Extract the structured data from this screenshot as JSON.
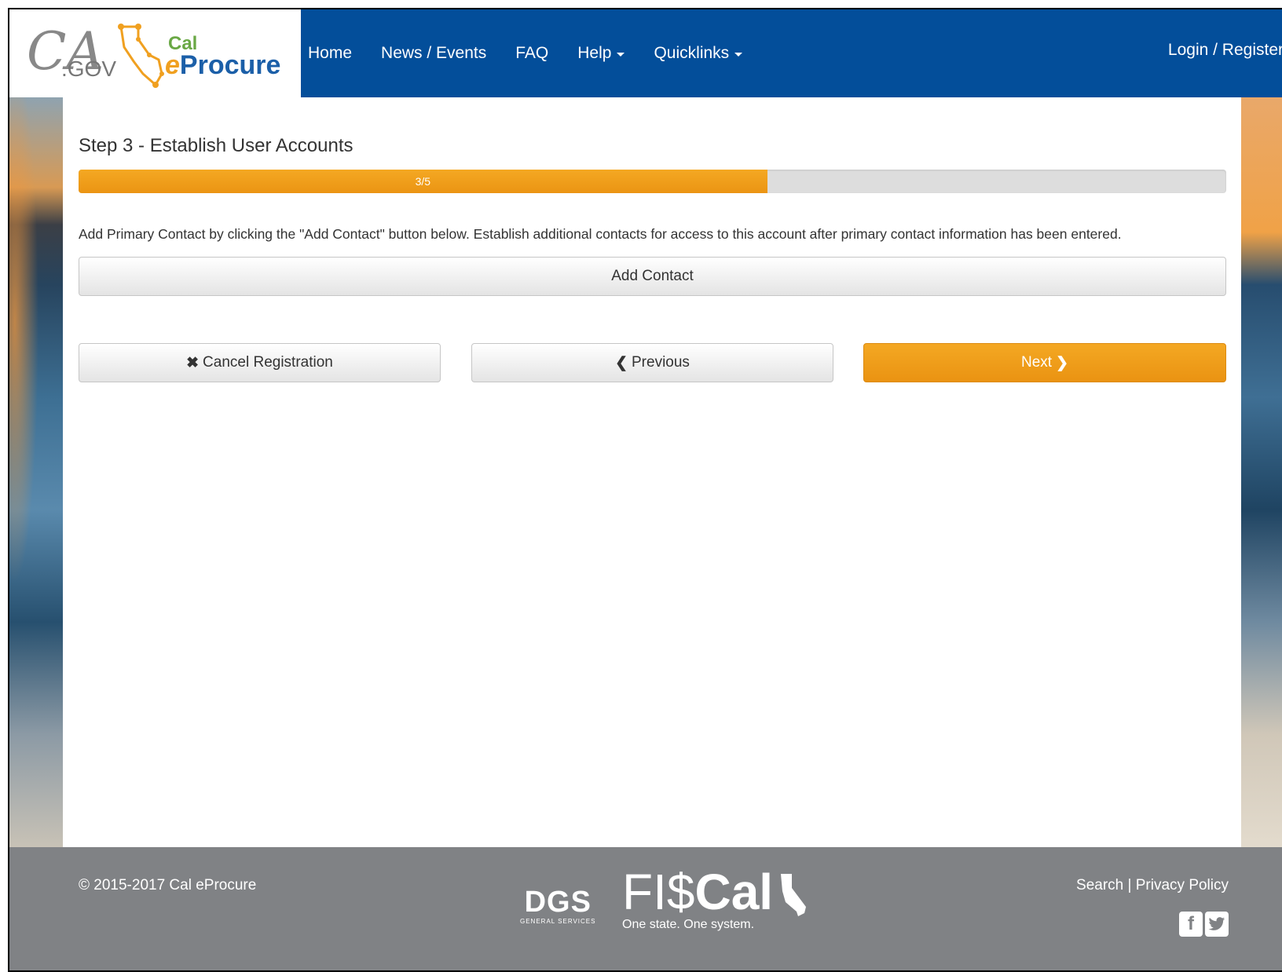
{
  "header": {
    "logo_ca_text": "CA",
    "logo_gov_text": ".GOV",
    "logo_cal_text": "Cal",
    "logo_eprocure_e": "e",
    "logo_eprocure_text": "Procure",
    "nav": {
      "home": "Home",
      "news": "News / Events",
      "faq": "FAQ",
      "help": "Help",
      "quicklinks": "Quicklinks"
    },
    "login": "Login / Register"
  },
  "main": {
    "step_title": "Step 3 - Establish User Accounts",
    "progress": {
      "label": "3/5",
      "current": 3,
      "total": 5,
      "fraction": 0.6
    },
    "instructions": "Add Primary Contact by clicking the \"Add Contact\" button below.  Establish additional contacts for access to this account after primary contact information has been entered.",
    "add_contact_label": "Add Contact",
    "cancel_label": "Cancel Registration",
    "previous_label": "Previous",
    "next_label": "Next",
    "icons": {
      "cancel": "times-icon",
      "previous": "chevron-left-icon",
      "next": "chevron-right-icon"
    }
  },
  "footer": {
    "copyright": "© 2015-2017 Cal eProcure",
    "dgs_logo": "DGS",
    "dgs_sub": "GENERAL SERVICES",
    "fiscal_logo_fis": "FI$",
    "fiscal_logo_cal": "Cal",
    "fiscal_tagline": "One state. One system.",
    "search": "Search",
    "separator": "|",
    "privacy": "Privacy Policy",
    "social": {
      "facebook": "f",
      "twitter": "t"
    }
  },
  "colors": {
    "header_blue": "#034e9a",
    "accent_orange": "#f0a020",
    "footer_gray": "#808285",
    "progress_track": "#dddddd"
  }
}
